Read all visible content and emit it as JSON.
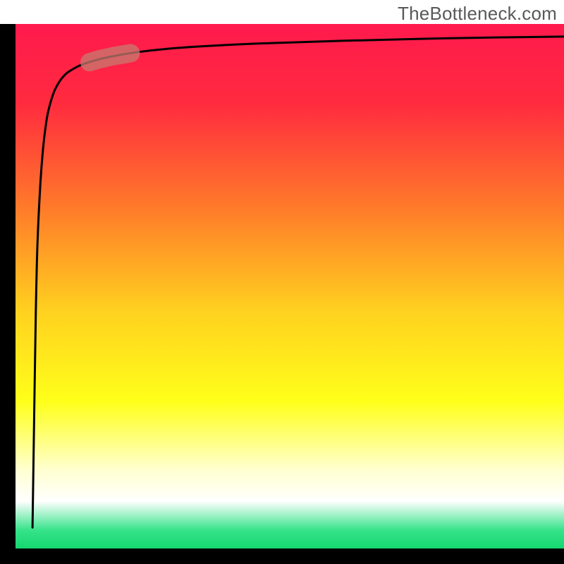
{
  "watermark": "TheBottleneck.com",
  "chart_data": {
    "type": "line",
    "title": "",
    "xlabel": "",
    "ylabel": "",
    "xlim": [
      0,
      100
    ],
    "ylim": [
      0,
      100
    ],
    "gradient_stops": [
      {
        "offset": 0.0,
        "color": "#ff1a4d"
      },
      {
        "offset": 0.15,
        "color": "#ff2a3f"
      },
      {
        "offset": 0.35,
        "color": "#ff7a2a"
      },
      {
        "offset": 0.55,
        "color": "#ffd21f"
      },
      {
        "offset": 0.72,
        "color": "#ffff1a"
      },
      {
        "offset": 0.85,
        "color": "#ffffd0"
      },
      {
        "offset": 0.91,
        "color": "#ffffff"
      },
      {
        "offset": 0.965,
        "color": "#36e38a"
      },
      {
        "offset": 1.0,
        "color": "#15d66f"
      }
    ],
    "series": [
      {
        "name": "bottleneck-curve",
        "note": "Values estimated from pixel positions; y is percentage of plot height from bottom.",
        "x": [
          3.1,
          3.4,
          3.7,
          4.0,
          4.5,
          5.0,
          5.5,
          6.0,
          7.0,
          8.0,
          9.0,
          10.0,
          12.0,
          15.0,
          18.0,
          22.0,
          28.0,
          35.0,
          45.0,
          60.0,
          80.0,
          100.0
        ],
        "y": [
          4.0,
          25.0,
          45.0,
          58.0,
          69.0,
          76.0,
          80.5,
          83.5,
          87.0,
          89.0,
          90.3,
          91.1,
          92.2,
          93.2,
          93.9,
          94.6,
          95.3,
          95.8,
          96.3,
          96.8,
          97.3,
          97.6
        ]
      }
    ],
    "highlight_segment": {
      "note": "Semi-transparent capsule over the curve near the knee.",
      "x_start": 13.5,
      "x_end": 21.0,
      "thickness_px": 26,
      "color": "#c77b70",
      "opacity": 0.75
    },
    "axes": {
      "color": "#000000",
      "left_thickness_px": 22,
      "bottom_thickness_px": 22
    }
  }
}
